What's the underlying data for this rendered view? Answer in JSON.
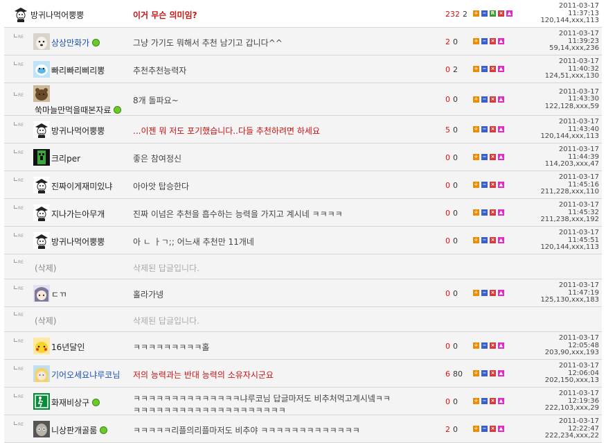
{
  "reply_marker": "RE",
  "action_buttons": {
    "plus": "+",
    "minus": "−",
    "reply": "R",
    "delete": "×",
    "report": "▲"
  },
  "comments": [
    {
      "nick": "방귀나먹어뿡뿡",
      "avatar": "guy-icon",
      "content": "이거 무슨 의미임?",
      "up": "232",
      "down": "2",
      "date": "2011-03-17",
      "time": "11:37:13",
      "ip": "120,144,xxx,113",
      "online": false
    },
    {
      "nick": "상상만화가",
      "avatar": "dog-icon",
      "content": "그냥 가기도 뭐해서 추천 남기고 갑니다^^",
      "up": "2",
      "down": "0",
      "date": "2011-03-17",
      "time": "11:39:23",
      "ip": "59,14,xxx,236",
      "online": true
    },
    {
      "nick": "빠리빠리삐리뽕",
      "avatar": "baby-icon",
      "content": "추천추천능력자",
      "up": "0",
      "down": "2",
      "date": "2011-03-17",
      "time": "11:40:32",
      "ip": "124,51,xxx,130",
      "online": false
    },
    {
      "nick": "쑥마늘만먹을때본자료",
      "avatar": "bear-icon",
      "content": "8개 돌파요~",
      "up": "0",
      "down": "0",
      "date": "2011-03-17",
      "time": "11:43:30",
      "ip": "122,128,xxx,59",
      "online": true
    },
    {
      "nick": "방귀나먹어뿡뿡",
      "avatar": "guy-icon",
      "content": "...이젠 뭐 저도 포기했습니다..다들 추천하려면 하세요",
      "up": "5",
      "down": "0",
      "date": "2011-03-17",
      "time": "11:43:40",
      "ip": "120,144,xxx,113",
      "online": false
    },
    {
      "nick": "크리per",
      "avatar": "creeper-icon",
      "content": "좋은 참여정신",
      "up": "0",
      "down": "0",
      "date": "2011-03-17",
      "time": "11:44:39",
      "ip": "114,203,xxx,47",
      "online": false
    },
    {
      "nick": "진짜이게재미있냐",
      "avatar": "guy-icon",
      "content": "아아앗 탑승한다",
      "up": "0",
      "down": "0",
      "date": "2011-03-17",
      "time": "11:45:16",
      "ip": "211,228,xxx,110",
      "online": false
    },
    {
      "nick": "지나가는아무개",
      "avatar": "guy-icon",
      "content": "진짜 이넘은 추천을 흡수하는 능력을 가지고 계시네 ㅋㅋㅋㅋ",
      "up": "0",
      "down": "0",
      "date": "2011-03-17",
      "time": "11:45:32",
      "ip": "211,238,xxx,192",
      "online": false
    },
    {
      "nick": "방귀나먹어뿡뿡",
      "avatar": "guy-icon",
      "content": "아   ㄴ ㅏㄱ;; 어느새 추천만 11개네",
      "up": "0",
      "down": "0",
      "date": "2011-03-17",
      "time": "11:45:51",
      "ip": "120,144,xxx,113",
      "online": false
    },
    {
      "nick": "(삭제)",
      "avatar": "",
      "content": "삭제된 답글입니다.",
      "up": "",
      "down": "",
      "date": "",
      "time": "",
      "ip": "",
      "online": false
    },
    {
      "nick": "ㄷㄲ",
      "avatar": "anime-icon",
      "content": "홀라가넹",
      "up": "0",
      "down": "0",
      "date": "2011-03-17",
      "time": "11:47:19",
      "ip": "125,130,xxx,183",
      "online": false
    },
    {
      "nick": "(삭제)",
      "avatar": "",
      "content": "삭제된 답글입니다.",
      "up": "",
      "down": "",
      "date": "",
      "time": "",
      "ip": "",
      "online": false
    },
    {
      "nick": "16년달인",
      "avatar": "pikachu-icon",
      "content": "ㅋㅋㅋㅋㅋㅋㅋㅋㅋ홀",
      "up": "0",
      "down": "0",
      "date": "2011-03-17",
      "time": "12:05:48",
      "ip": "203,90,xxx,193",
      "online": false
    },
    {
      "nick": "기어오세요냐루코님",
      "avatar": "blonde-icon",
      "content": "저의 능력과는 반대 능력의 소유자시군요",
      "up": "6",
      "down": "80",
      "date": "2011-03-17",
      "time": "12:06:04",
      "ip": "202,150,xxx,13",
      "online": false
    },
    {
      "nick": "화재비상구",
      "avatar": "exit-icon",
      "content": "ㅋㅋㅋㅋㅋㅋㅋㅋㅋㅋㅋㅋㅋㅋ냐루코님 답글마저도 비추처먹고계시넼ㅋㅋ",
      "content2": "ㅋㅋㅋㅋㅋㅋㅋㅋㅋㅋㅋㅋㅋㅋㅋㅋㅋㅋㅋㅋ",
      "up": "0",
      "down": "0",
      "date": "2011-03-17",
      "time": "12:19:36",
      "ip": "222,103,xxx,29",
      "online": true
    },
    {
      "nick": "니상판개골룸",
      "avatar": "gollum-icon",
      "content": "ㅋㅋㅋㅋㅋ리플의리플마저도 비추야 ㅋㅋㅋㅋㅋㅋㅋㅋㅋㅋㅋㅋㅋ",
      "up": "2",
      "down": "0",
      "date": "2011-03-17",
      "time": "12:22:47",
      "ip": "222,234,xxx,22",
      "online": true
    }
  ],
  "colors": {
    "recommend_count": "#e01010",
    "highlight_text": "#cc1111",
    "nick_blue": "#1a50b8",
    "online_dot": "#6cc92a",
    "row_bg": "#f4f4f4",
    "row_border": "#d6d6d6"
  }
}
